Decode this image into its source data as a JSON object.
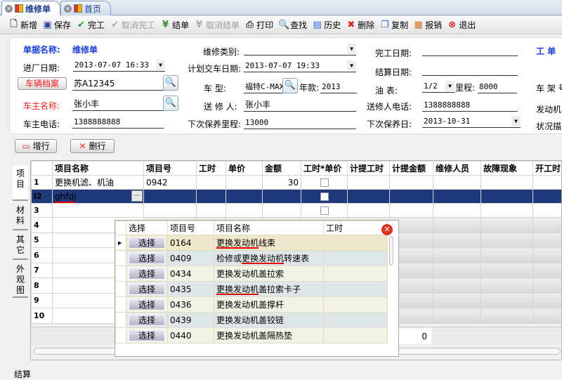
{
  "tabs": [
    {
      "label": "维修单",
      "active": true
    },
    {
      "label": "首页",
      "active": false
    }
  ],
  "toolbar": [
    {
      "label": "新增",
      "icon": "new-document-icon",
      "enabled": true
    },
    {
      "label": "保存",
      "icon": "save-disk-icon",
      "enabled": true
    },
    {
      "label": "完工",
      "icon": "checkmark-icon",
      "enabled": true
    },
    {
      "label": "取消完工",
      "icon": "checkmark-icon",
      "enabled": false
    },
    {
      "label": "结单",
      "icon": "yen-icon",
      "enabled": true
    },
    {
      "label": "取消结单",
      "icon": "yen-icon",
      "enabled": false
    },
    {
      "label": "打印",
      "icon": "printer-icon",
      "enabled": true
    },
    {
      "label": "查找",
      "icon": "search-icon",
      "enabled": true
    },
    {
      "label": "历史",
      "icon": "history-icon",
      "enabled": true
    },
    {
      "label": "删除",
      "icon": "delete-x-icon",
      "enabled": true
    },
    {
      "label": "复制",
      "icon": "copy-icon",
      "enabled": true
    },
    {
      "label": "报销",
      "icon": "report-icon",
      "enabled": true
    },
    {
      "label": "退出",
      "icon": "exit-icon",
      "enabled": true
    }
  ],
  "form": {
    "doc_name_label": "单据名称:",
    "doc_name": "维修单",
    "repair_type_label": "维修类别:",
    "repair_type": "",
    "finish_date_label": "完工日期:",
    "finish_date": "",
    "work_order_label": "工 单",
    "entry_date_label": "进厂日期:",
    "entry_date": "2013-07-07 16:33",
    "plan_date_label": "计划交车日期:",
    "plan_date": "2013-07-07 19:33",
    "settle_date_label": "结算日期:",
    "settle_date": "",
    "vehicle_file_button": "车辆档案",
    "plate": "苏A12345",
    "model_label": "车    型:",
    "model": "福特C-MAX",
    "year_label": "年款:",
    "year": "2013",
    "fuel_label": "油    表:",
    "fuel": "1/2",
    "mileage_label": "里程:",
    "mileage": "8000",
    "vin_label": "车 架 号",
    "owner_label": "车主名称:",
    "owner": "张小丰",
    "sender_label": "送 修 人:",
    "sender": "张小丰",
    "sender_phone_label": "送修人电话:",
    "sender_phone": "1388888888",
    "engine_label": "发动机号",
    "owner_phone_label": "车主电话:",
    "owner_phone": "1388888888",
    "next_mileage_label": "下次保养里程:",
    "next_mileage": "13000",
    "next_date_label": "下次保养日:",
    "next_date": "2013-10-31",
    "condition_label": "状况描述"
  },
  "row_buttons": {
    "add": "增行",
    "delete": "删行"
  },
  "side_tabs": [
    "项目",
    "材料",
    "其它",
    "外观图"
  ],
  "grid": {
    "columns": [
      "项目名称",
      "项目号",
      "工时",
      "单价",
      "金额",
      "工时*单价",
      "计提工时",
      "计提金额",
      "维修人员",
      "故障现象",
      "开工时"
    ],
    "rows": [
      {
        "num": "1",
        "name": "更换机滤、机油",
        "code": "0942",
        "amount": "30"
      },
      {
        "num": "2",
        "name": "ghfdj",
        "code": "",
        "amount": ""
      },
      {
        "num": "3"
      },
      {
        "num": "4"
      },
      {
        "num": "5"
      },
      {
        "num": "6"
      },
      {
        "num": "7"
      },
      {
        "num": "8"
      },
      {
        "num": "9"
      },
      {
        "num": "10"
      }
    ],
    "footer_total": "0"
  },
  "popup": {
    "columns": [
      "选择",
      "项目号",
      "项目名称",
      "工时"
    ],
    "select_label": "选择",
    "rows": [
      {
        "code": "0164",
        "name": "更换发动机线束"
      },
      {
        "code": "0409",
        "name": "检修或更换发动机转速表"
      },
      {
        "code": "0434",
        "name": "更换发动机盖拉索"
      },
      {
        "code": "0435",
        "name": "更换发动机盖拉索卡子"
      },
      {
        "code": "0436",
        "name": "更换发动机盖撑杆"
      },
      {
        "code": "0439",
        "name": "更换发动机盖铰链"
      },
      {
        "code": "0440",
        "name": "更换发动机盖隔热垫"
      }
    ]
  },
  "bottom_label": "结算",
  "colors": {
    "accent_blue": "#1a3de0",
    "required_red": "#ff0000",
    "selected_row": "#1f3a7a"
  }
}
